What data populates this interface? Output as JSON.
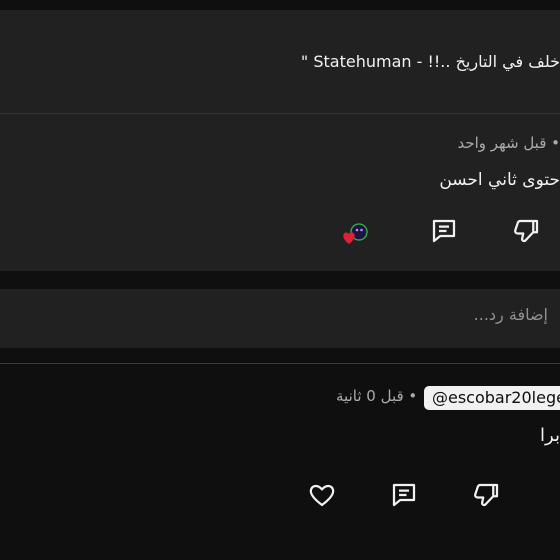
{
  "comment_top": {
    "quote_text": "خلف في التاريخ ..!! - Statehuman \""
  },
  "comment1": {
    "meta": "• قبل شهر واحد",
    "text": "حتوى ثاني احسن",
    "actions": {
      "creator_heart": "creator-heart-icon",
      "reply": "reply-icon",
      "dislike": "dislike-icon"
    }
  },
  "reply_box": {
    "placeholder": "إضافة رد..."
  },
  "comment2": {
    "mention": "@escobar20lege",
    "meta": "• قبل 0 ثانية",
    "text": "برا",
    "actions": {
      "like": "heart-outline-icon",
      "reply": "reply-icon",
      "dislike": "dislike-icon"
    }
  },
  "colors": {
    "background": "#0f0f0f",
    "panel": "#212121",
    "heart_red": "#e0203a",
    "muted_text": "#aaaaaa"
  }
}
